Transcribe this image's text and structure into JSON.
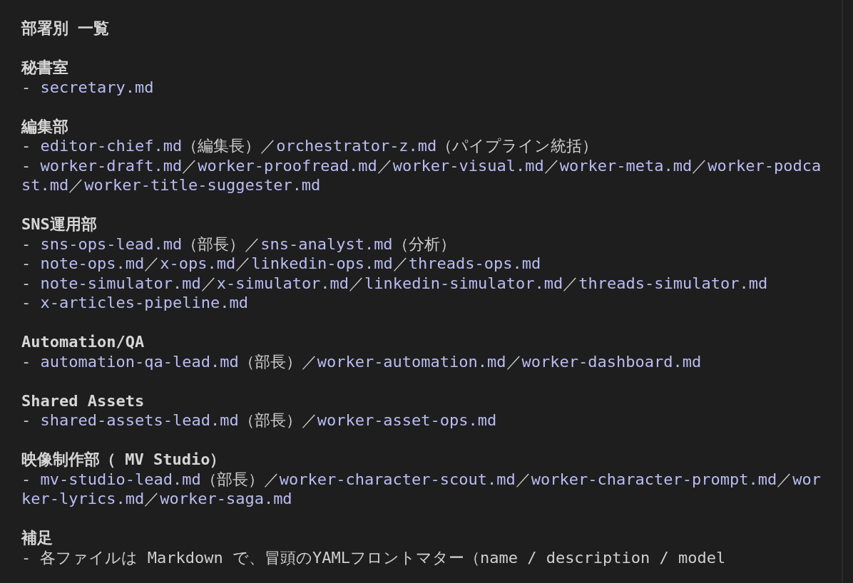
{
  "title": "部署別 一覧",
  "sections": [
    {
      "heading": "秘書室",
      "lines": [
        [
          {
            "kind": "plain",
            "text": "- "
          },
          {
            "kind": "file",
            "text": "secretary.md"
          }
        ]
      ]
    },
    {
      "heading": "編集部",
      "lines": [
        [
          {
            "kind": "plain",
            "text": "- "
          },
          {
            "kind": "file",
            "text": "editor-chief.md"
          },
          {
            "kind": "plain",
            "text": "（編集長）／"
          },
          {
            "kind": "file",
            "text": "orchestrator-z.md"
          },
          {
            "kind": "plain",
            "text": "（パイプライン統括）"
          }
        ],
        [
          {
            "kind": "plain",
            "text": "- "
          },
          {
            "kind": "file",
            "text": "worker-draft.md"
          },
          {
            "kind": "plain",
            "text": "／"
          },
          {
            "kind": "file",
            "text": "worker-proofread.md"
          },
          {
            "kind": "plain",
            "text": "／"
          },
          {
            "kind": "file",
            "text": "worker-visual.md"
          },
          {
            "kind": "plain",
            "text": "／"
          },
          {
            "kind": "file",
            "text": "worker-meta.md"
          },
          {
            "kind": "plain",
            "text": "／"
          },
          {
            "kind": "file",
            "text": "worker-podcast.md"
          },
          {
            "kind": "plain",
            "text": "／"
          },
          {
            "kind": "file",
            "text": "worker-title-suggester.md"
          }
        ]
      ]
    },
    {
      "heading": "SNS運用部",
      "lines": [
        [
          {
            "kind": "plain",
            "text": "- "
          },
          {
            "kind": "file",
            "text": "sns-ops-lead.md"
          },
          {
            "kind": "plain",
            "text": "（部長）／"
          },
          {
            "kind": "file",
            "text": "sns-analyst.md"
          },
          {
            "kind": "plain",
            "text": "（分析）"
          }
        ],
        [
          {
            "kind": "plain",
            "text": "- "
          },
          {
            "kind": "file",
            "text": "note-ops.md"
          },
          {
            "kind": "plain",
            "text": "／"
          },
          {
            "kind": "file",
            "text": "x-ops.md"
          },
          {
            "kind": "plain",
            "text": "／"
          },
          {
            "kind": "file",
            "text": "linkedin-ops.md"
          },
          {
            "kind": "plain",
            "text": "／"
          },
          {
            "kind": "file",
            "text": "threads-ops.md"
          }
        ],
        [
          {
            "kind": "plain",
            "text": "- "
          },
          {
            "kind": "file",
            "text": "note-simulator.md"
          },
          {
            "kind": "plain",
            "text": "／"
          },
          {
            "kind": "file",
            "text": "x-simulator.md"
          },
          {
            "kind": "plain",
            "text": "／"
          },
          {
            "kind": "file",
            "text": "linkedin-simulator.md"
          },
          {
            "kind": "plain",
            "text": "／"
          },
          {
            "kind": "file",
            "text": "threads-simulator.md"
          }
        ],
        [
          {
            "kind": "plain",
            "text": "- "
          },
          {
            "kind": "file",
            "text": "x-articles-pipeline.md"
          }
        ]
      ]
    },
    {
      "heading": "Automation/QA",
      "lines": [
        [
          {
            "kind": "plain",
            "text": "- "
          },
          {
            "kind": "file",
            "text": "automation-qa-lead.md"
          },
          {
            "kind": "plain",
            "text": "（部長）／"
          },
          {
            "kind": "file",
            "text": "worker-automation.md"
          },
          {
            "kind": "plain",
            "text": "／"
          },
          {
            "kind": "file",
            "text": "worker-dashboard.md"
          }
        ]
      ]
    },
    {
      "heading": "Shared Assets",
      "lines": [
        [
          {
            "kind": "plain",
            "text": "- "
          },
          {
            "kind": "file",
            "text": "shared-assets-lead.md"
          },
          {
            "kind": "plain",
            "text": "（部長）／"
          },
          {
            "kind": "file",
            "text": "worker-asset-ops.md"
          }
        ]
      ]
    },
    {
      "heading": "映像制作部（ MV Studio）",
      "lines": [
        [
          {
            "kind": "plain",
            "text": "- "
          },
          {
            "kind": "file",
            "text": "mv-studio-lead.md"
          },
          {
            "kind": "plain",
            "text": "（部長）／"
          },
          {
            "kind": "file",
            "text": "worker-character-scout.md"
          },
          {
            "kind": "plain",
            "text": "／"
          },
          {
            "kind": "file",
            "text": "worker-character-prompt.md"
          },
          {
            "kind": "plain",
            "text": "／"
          },
          {
            "kind": "file",
            "text": "worker-lyrics.md"
          },
          {
            "kind": "plain",
            "text": "／"
          },
          {
            "kind": "file",
            "text": "worker-saga.md"
          }
        ]
      ]
    },
    {
      "heading": "補足",
      "lines": [
        [
          {
            "kind": "plain",
            "text": "- 各ファイルは Markdown で、冒頭のYAMLフロントマター（name / description / model"
          }
        ]
      ]
    }
  ]
}
